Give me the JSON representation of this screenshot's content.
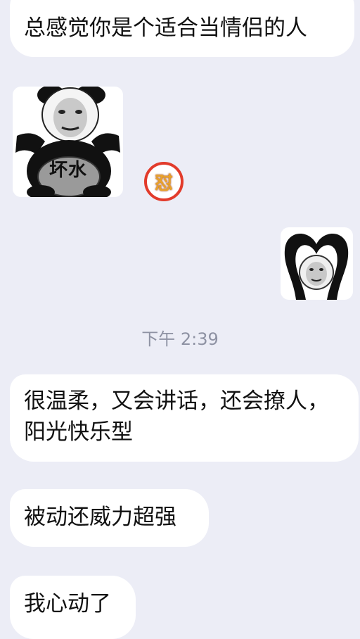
{
  "chat": {
    "messages": [
      {
        "text": "总感觉你是个适合当情侣的人"
      },
      {
        "text": "很温柔，又会讲话，还会撩人，\n阳光快乐型"
      },
      {
        "text": "被动还威力超强"
      },
      {
        "text": "我心动了"
      }
    ],
    "stickers": [
      {
        "caption": "坏水",
        "icon": "panda-meme-sticker"
      },
      {
        "icon": "panda-heart-arms-sticker"
      }
    ],
    "reaction": {
      "glyph": "怼",
      "icon": "reaction-badge"
    },
    "timestamp": "下午 2:39"
  },
  "colors": {
    "background": "#ECEDF6",
    "bubble": "#FFFFFF",
    "text": "#111111",
    "timestamp": "#8E92A3",
    "reaction_ring": "#E23B2B"
  }
}
